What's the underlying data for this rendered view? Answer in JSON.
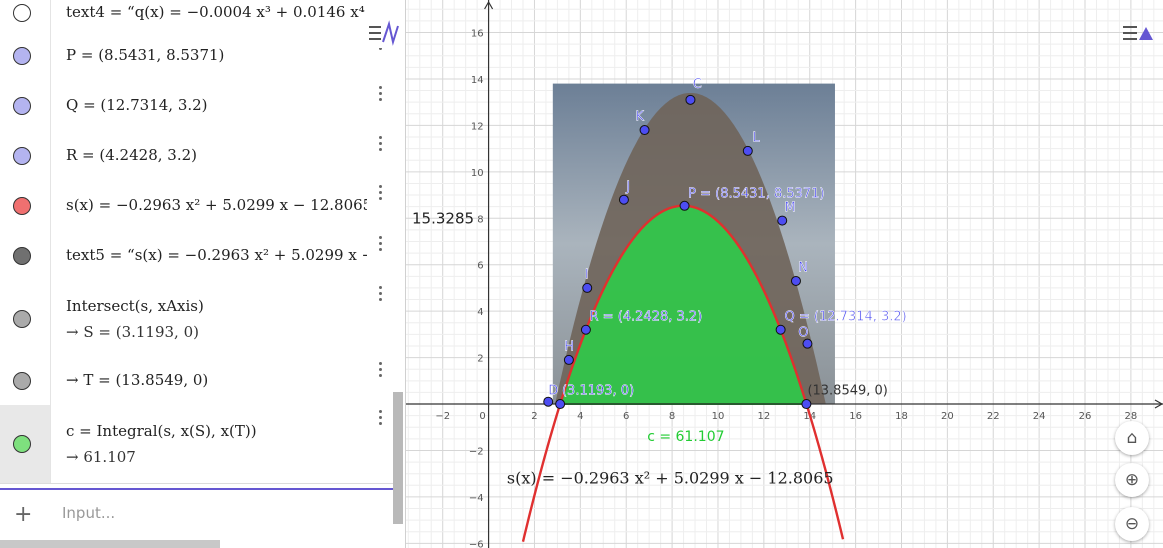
{
  "algebra": {
    "rows": [
      {
        "id": "text4",
        "line1": "text4  =  “q(x)  =  −0.0004 x³ + 0.0146 x⁴",
        "line2": "",
        "color": "#ffffff"
      },
      {
        "id": "P",
        "line1": "P  =  (8.5431, 8.5371)",
        "line2": "",
        "color": "#b4b4f0"
      },
      {
        "id": "Q",
        "line1": "Q  =  (12.7314, 3.2)",
        "line2": "",
        "color": "#b4b4f0"
      },
      {
        "id": "R",
        "line1": "R  =  (4.2428, 3.2)",
        "line2": "",
        "color": "#b4b4f0"
      },
      {
        "id": "s",
        "line1": "s(x)  =  −0.2963 x²  +  5.0299 x  −  12.8065",
        "line2": "",
        "color": "#f07070"
      },
      {
        "id": "text5",
        "line1": "text5  =  “s(x)  =  −0.2963 x²  +  5.0299 x  −  12.",
        "line2": "",
        "color": "#707070"
      },
      {
        "id": "intersect",
        "line1": "Intersect(s, xAxis)",
        "line2": "→  S  =  (3.1193, 0)",
        "color": "#aaaaaa"
      },
      {
        "id": "T",
        "line1": "→  T  =  (13.8549, 0)",
        "line2": "",
        "color": "#aaaaaa"
      },
      {
        "id": "c",
        "line1": "c  =  Integral(s, x(S), x(T))",
        "line2": "→  61.107",
        "color": "#7ee07e"
      }
    ],
    "input_placeholder": "Input..."
  },
  "graph": {
    "x_ticks": [
      "−2",
      "0",
      "2",
      "4",
      "6",
      "8",
      "10",
      "12",
      "14",
      "16",
      "18",
      "20",
      "22",
      "24",
      "26",
      "28"
    ],
    "y_ticks": [
      "16",
      "14",
      "12",
      "10",
      "8",
      "6",
      "4",
      "2",
      "−2",
      "−4",
      "−6"
    ],
    "xmin": -3.6,
    "xmax": 29.4,
    "ymin": -6.2,
    "ymax": 17.4,
    "parabola": {
      "a": -0.2963,
      "b": 5.0299,
      "c": -12.8065,
      "color": "#e03030"
    },
    "fill_color": "#22dd44",
    "image_extent": {
      "x0": 2.8,
      "x1": 15.1,
      "y0": 0,
      "y1": 13.8
    },
    "points": [
      {
        "label": "C",
        "x": 8.8,
        "y": 13.1
      },
      {
        "label": "K",
        "x": 6.8,
        "y": 11.8
      },
      {
        "label": "L",
        "x": 11.3,
        "y": 10.9
      },
      {
        "label": "J",
        "x": 5.9,
        "y": 8.8
      },
      {
        "label": "P",
        "x": 8.5431,
        "y": 8.5371
      },
      {
        "label": "M",
        "x": 12.8,
        "y": 7.9
      },
      {
        "label": "N",
        "x": 13.4,
        "y": 5.3
      },
      {
        "label": "I",
        "x": 4.3,
        "y": 5.0
      },
      {
        "label": "R",
        "x": 4.2428,
        "y": 3.2
      },
      {
        "label": "Q",
        "x": 12.7314,
        "y": 3.2
      },
      {
        "label": "O",
        "x": 13.9,
        "y": 2.6
      },
      {
        "label": "H",
        "x": 3.5,
        "y": 1.9
      },
      {
        "label": "D",
        "x": 2.6,
        "y": 0.1
      },
      {
        "label": "S",
        "x": 3.1193,
        "y": 0
      },
      {
        "label": "T",
        "x": 13.8549,
        "y": 0
      }
    ],
    "point_labels": [
      {
        "text": "C",
        "x": 8.9,
        "y": 13.6
      },
      {
        "text": "K",
        "x": 6.4,
        "y": 12.2
      },
      {
        "text": "L",
        "x": 11.5,
        "y": 11.3
      },
      {
        "text": "J",
        "x": 6.0,
        "y": 9.2
      },
      {
        "text": "P = (8.5431, 8.5371)",
        "x": 8.7,
        "y": 8.9
      },
      {
        "text": "M",
        "x": 12.9,
        "y": 8.3
      },
      {
        "text": "N",
        "x": 13.5,
        "y": 5.7
      },
      {
        "text": "I",
        "x": 4.2,
        "y": 5.4
      },
      {
        "text": "R = (4.2428, 3.2)",
        "x": 4.4,
        "y": 3.6
      },
      {
        "text": "Q = (12.7314, 3.2)",
        "x": 12.9,
        "y": 3.6
      },
      {
        "text": "O",
        "x": 13.5,
        "y": 2.9
      },
      {
        "text": "H",
        "x": 3.3,
        "y": 2.3
      },
      {
        "text": "D",
        "x": 2.6,
        "y": 0.4
      },
      {
        "text": "(3.1193, 0)",
        "x": 3.2,
        "y": 0.4
      },
      {
        "text": "(13.8549, 0)",
        "x": 13.9,
        "y": 0.4
      }
    ],
    "value_label": "15.3285",
    "integral_label": "c = 61.107",
    "function_text": "s(x)  =  −0.2963 x²  +  5.0299 x  −  12.8065"
  }
}
